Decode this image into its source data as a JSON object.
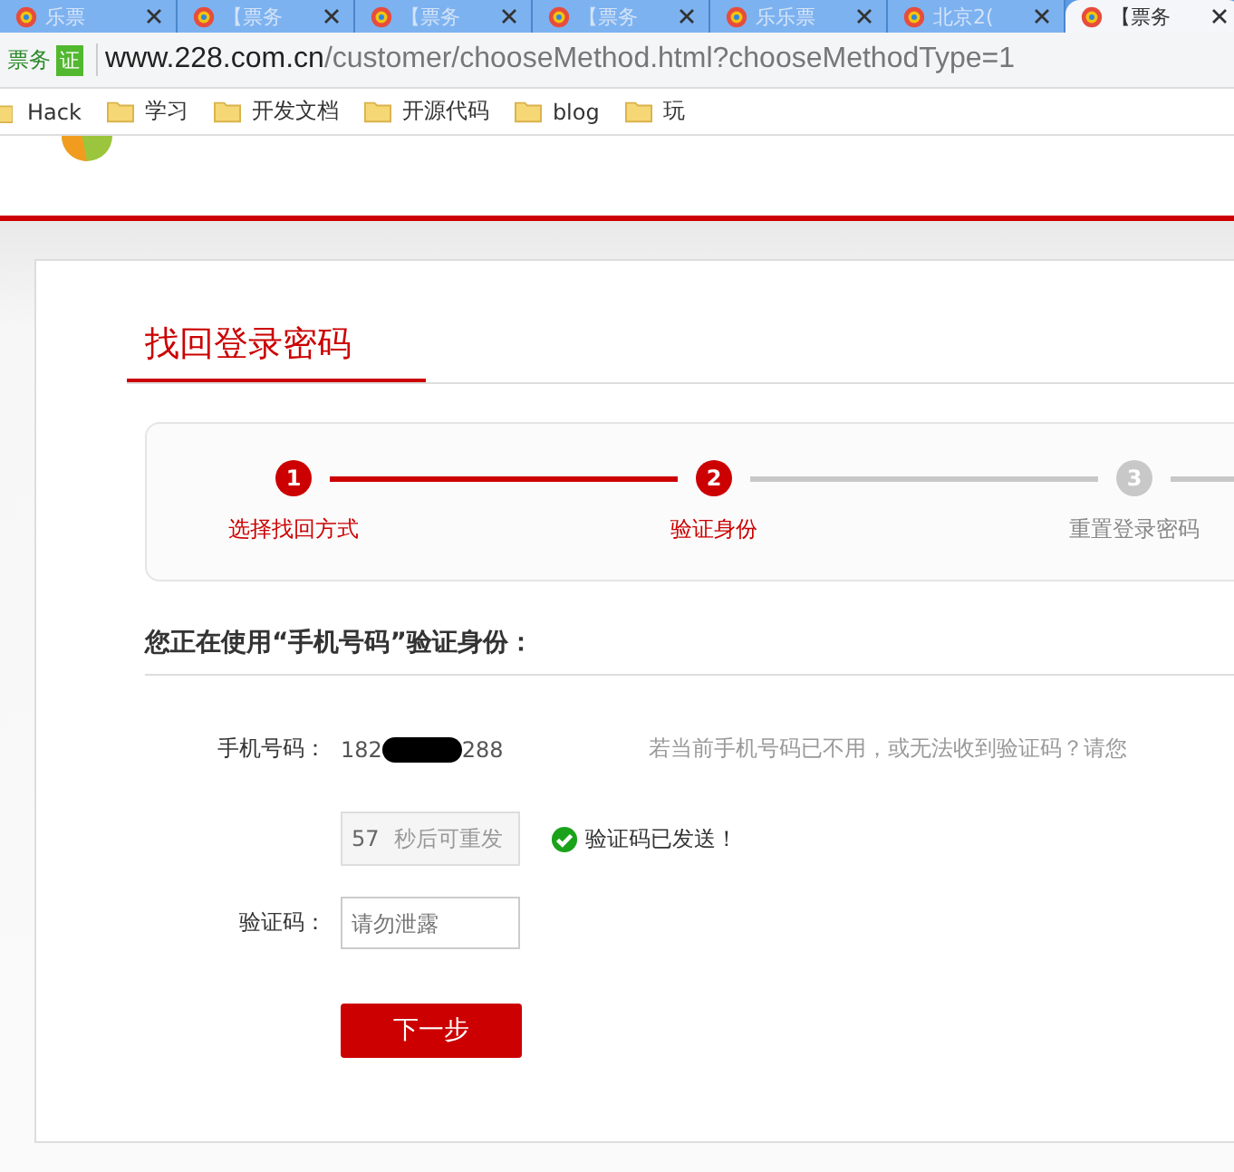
{
  "browser": {
    "tabs": [
      {
        "title": "乐票",
        "selected": false
      },
      {
        "title": "【票务",
        "selected": false
      },
      {
        "title": "【票务",
        "selected": false
      },
      {
        "title": "【票务",
        "selected": false
      },
      {
        "title": "乐乐票",
        "selected": false
      },
      {
        "title": "北京2(",
        "selected": false
      },
      {
        "title": "【票务",
        "selected": true
      }
    ],
    "site_name": "票务",
    "site_badge": "证",
    "url_host": "www.228.com.cn",
    "url_path": "/customer/chooseMethod.html?chooseMethodType=1",
    "bookmarks": [
      "Hack",
      "学习",
      "开发文档",
      "开源代码",
      "blog",
      "玩"
    ]
  },
  "page": {
    "title": "找回登录密码",
    "steps": [
      {
        "number": "1",
        "label": "选择找回方式",
        "reached": true
      },
      {
        "number": "2",
        "label": "验证身份",
        "reached": true
      },
      {
        "number": "3",
        "label": "重置登录密码",
        "reached": false
      }
    ],
    "heading": "您正在使用“**手机号码**”验证身份：",
    "phone_label": "手机号码：",
    "phone_start": "182",
    "phone_end": "288",
    "help_text": "若当前手机号码已不用，或无法收到验证码？请您",
    "resend_count": "57",
    "resend_text": "秒后可重发",
    "resend_disabled": true,
    "sent_message": "验证码已发送！",
    "code_label": "验证码：",
    "code_placeholder": "请勿泄露",
    "next_button": "下一步"
  }
}
